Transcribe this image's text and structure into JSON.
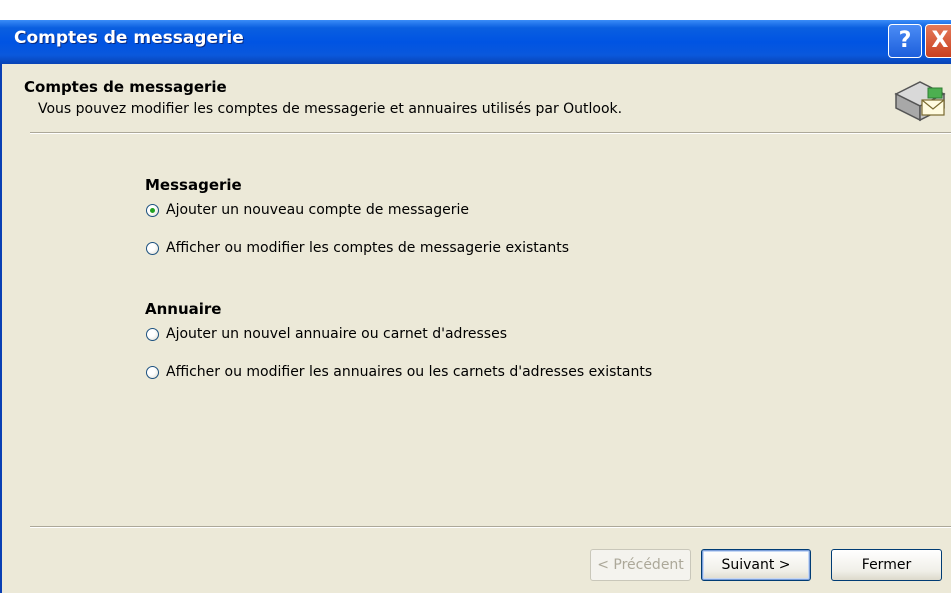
{
  "window": {
    "title": "Comptes de messagerie"
  },
  "header": {
    "title": "Comptes de messagerie",
    "subtitle": "Vous pouvez modifier les comptes de messagerie et annuaires utilisés par Outlook."
  },
  "sections": {
    "messagerie": {
      "title": "Messagerie",
      "options": [
        {
          "label": "Ajouter un nouveau compte de messagerie",
          "checked": true
        },
        {
          "label": "Afficher ou modifier les comptes de messagerie existants",
          "checked": false
        }
      ]
    },
    "annuaire": {
      "title": "Annuaire",
      "options": [
        {
          "label": "Ajouter un nouvel annuaire ou carnet d'adresses",
          "checked": false
        },
        {
          "label": "Afficher ou modifier les annuaires ou les carnets d'adresses existants",
          "checked": false
        }
      ]
    }
  },
  "buttons": {
    "back": "< Précédent",
    "next": "Suivant >",
    "close": "Fermer"
  },
  "icons": {
    "help": "?",
    "close": "X",
    "header": "mailbox-tray-icon"
  },
  "colors": {
    "titlebar": "#0054e3",
    "dialog_bg": "#ece9d8",
    "radio_dot": "#21a121"
  }
}
